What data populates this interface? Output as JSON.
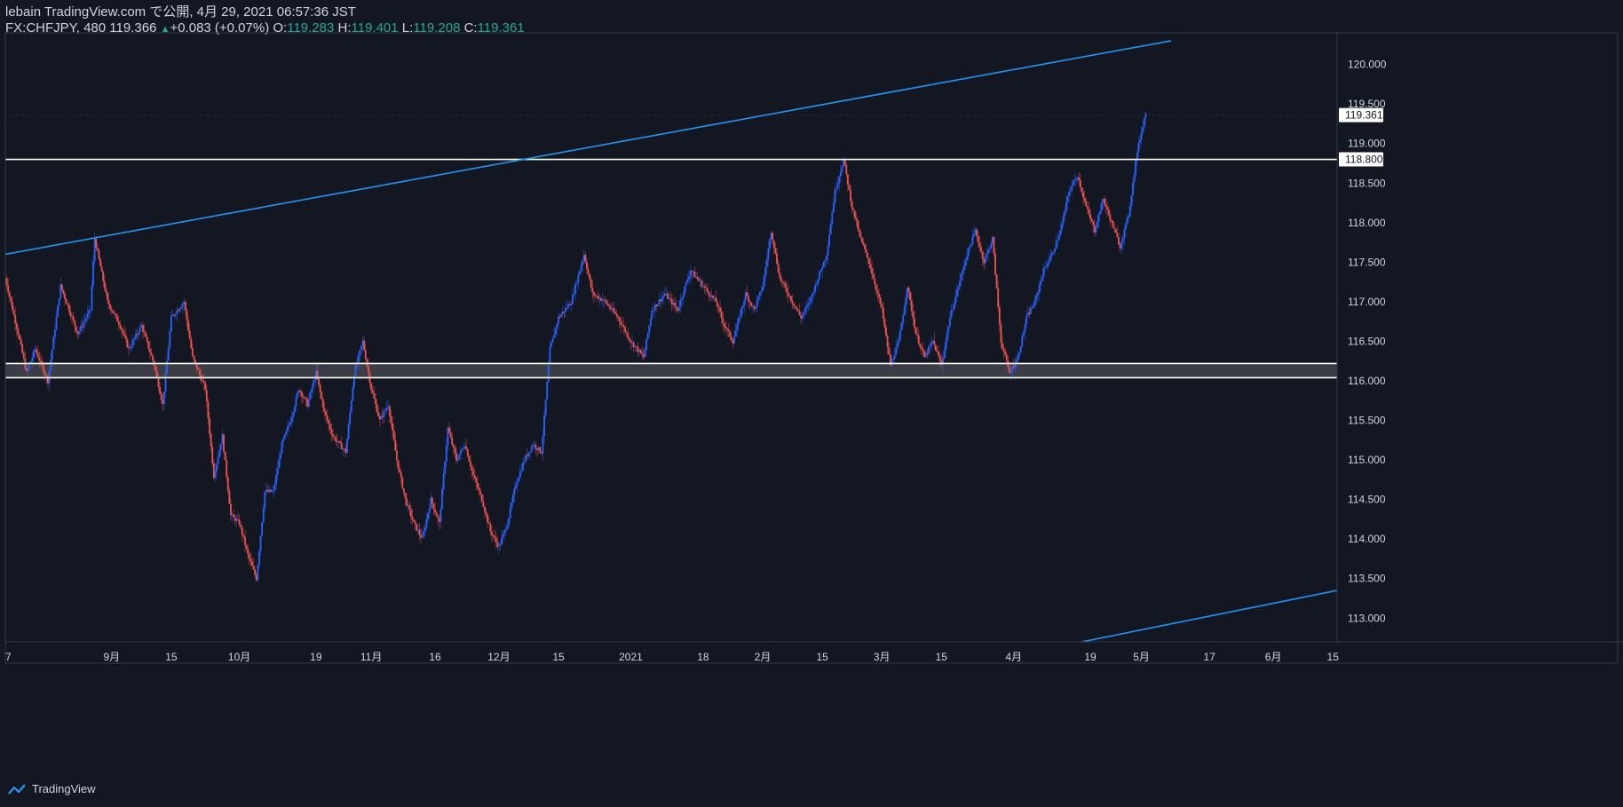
{
  "header": {
    "title": "lebain TradingView.com で公開, 4月 29, 2021 06:57:36 JST",
    "symbol_line": "FX:CHFJPY, 480 119.366",
    "change_arrow": "▲",
    "change": "+0.083 (+0.07%)",
    "o_label": "O:",
    "o_value": "119.283",
    "h_label": "H:",
    "h_value": "119.401",
    "l_label": "L:",
    "l_value": "119.208",
    "c_label": "C:",
    "c_value": "119.361"
  },
  "footer": {
    "brand": "TradingView"
  },
  "colors": {
    "background": "#131722",
    "up": "#2962ff",
    "down": "#ef5350",
    "trendline": "#2196f3",
    "level": "#ffffff",
    "zone_fill": "#3a3d45",
    "axis_text": "#d1d4dc",
    "price_tag_fill": "#ffffff",
    "price_tag_text": "#131722"
  },
  "chart_data": {
    "type": "candlestick",
    "symbol": "FX:CHFJPY",
    "interval": "480",
    "x_tick_labels": [
      "7",
      "9月",
      "15",
      "10月",
      "19",
      "11月",
      "16",
      "12月",
      "15",
      "2021",
      "18",
      "2月",
      "15",
      "3月",
      "15",
      "4月",
      "19",
      "5月",
      "17",
      "6月",
      "15"
    ],
    "x_tick_dates": [
      "2020-08-07",
      "2020-09-01",
      "2020-09-15",
      "2020-10-01",
      "2020-10-19",
      "2020-11-01",
      "2020-11-16",
      "2020-12-01",
      "2020-12-15",
      "2021-01-01",
      "2021-01-18",
      "2021-02-01",
      "2021-02-15",
      "2021-03-01",
      "2021-03-15",
      "2021-04-01",
      "2021-04-19",
      "2021-05-01",
      "2021-05-17",
      "2021-06-01",
      "2021-06-15"
    ],
    "y_ticks": [
      113.0,
      113.5,
      114.0,
      114.5,
      115.0,
      115.5,
      116.0,
      116.5,
      117.0,
      117.5,
      118.0,
      118.5,
      119.0,
      119.5,
      120.0
    ],
    "y_tick_labels": [
      "113.000",
      "113.500",
      "114.000",
      "114.500",
      "115.000",
      "115.500",
      "116.000",
      "116.500",
      "117.000",
      "117.500",
      "118.000",
      "118.500",
      "119.000",
      "119.500",
      "120.000"
    ],
    "ylim": [
      112.7,
      120.4
    ],
    "xlim": [
      "2020-08-07",
      "2021-06-16"
    ],
    "price_path": [
      [
        "2020-08-07",
        117.3
      ],
      [
        "2020-08-10",
        116.6
      ],
      [
        "2020-08-12",
        116.1
      ],
      [
        "2020-08-14",
        116.4
      ],
      [
        "2020-08-17",
        116.0
      ],
      [
        "2020-08-20",
        117.2
      ],
      [
        "2020-08-22",
        116.9
      ],
      [
        "2020-08-24",
        116.6
      ],
      [
        "2020-08-27",
        116.9
      ],
      [
        "2020-08-28",
        117.8
      ],
      [
        "2020-08-31",
        117.0
      ],
      [
        "2020-09-03",
        116.7
      ],
      [
        "2020-09-05",
        116.4
      ],
      [
        "2020-09-08",
        116.7
      ],
      [
        "2020-09-11",
        116.2
      ],
      [
        "2020-09-13",
        115.7
      ],
      [
        "2020-09-15",
        116.8
      ],
      [
        "2020-09-18",
        117.0
      ],
      [
        "2020-09-20",
        116.3
      ],
      [
        "2020-09-23",
        115.9
      ],
      [
        "2020-09-25",
        114.8
      ],
      [
        "2020-09-27",
        115.3
      ],
      [
        "2020-09-29",
        114.3
      ],
      [
        "2020-10-01",
        114.2
      ],
      [
        "2020-10-03",
        113.8
      ],
      [
        "2020-10-05",
        113.5
      ],
      [
        "2020-10-07",
        114.6
      ],
      [
        "2020-10-09",
        114.6
      ],
      [
        "2020-10-11",
        115.2
      ],
      [
        "2020-10-13",
        115.5
      ],
      [
        "2020-10-15",
        115.9
      ],
      [
        "2020-10-17",
        115.7
      ],
      [
        "2020-10-19",
        116.1
      ],
      [
        "2020-10-21",
        115.6
      ],
      [
        "2020-10-23",
        115.3
      ],
      [
        "2020-10-26",
        115.1
      ],
      [
        "2020-10-28",
        116.1
      ],
      [
        "2020-10-30",
        116.5
      ],
      [
        "2020-11-01",
        115.9
      ],
      [
        "2020-11-03",
        115.5
      ],
      [
        "2020-11-05",
        115.7
      ],
      [
        "2020-11-07",
        115.0
      ],
      [
        "2020-11-09",
        114.5
      ],
      [
        "2020-11-11",
        114.2
      ],
      [
        "2020-11-13",
        114.0
      ],
      [
        "2020-11-15",
        114.5
      ],
      [
        "2020-11-17",
        114.2
      ],
      [
        "2020-11-19",
        115.4
      ],
      [
        "2020-11-21",
        115.0
      ],
      [
        "2020-11-23",
        115.2
      ],
      [
        "2020-11-25",
        114.8
      ],
      [
        "2020-11-27",
        114.5
      ],
      [
        "2020-11-29",
        114.1
      ],
      [
        "2020-12-01",
        113.9
      ],
      [
        "2020-12-03",
        114.2
      ],
      [
        "2020-12-05",
        114.7
      ],
      [
        "2020-12-07",
        115.0
      ],
      [
        "2020-12-09",
        115.2
      ],
      [
        "2020-12-11",
        115.1
      ],
      [
        "2020-12-13",
        116.4
      ],
      [
        "2020-12-15",
        116.8
      ],
      [
        "2020-12-18",
        117.0
      ],
      [
        "2020-12-21",
        117.6
      ],
      [
        "2020-12-23",
        117.1
      ],
      [
        "2020-12-26",
        117.0
      ],
      [
        "2020-12-29",
        116.8
      ],
      [
        "2021-01-01",
        116.5
      ],
      [
        "2021-01-04",
        116.3
      ],
      [
        "2021-01-06",
        116.9
      ],
      [
        "2021-01-09",
        117.1
      ],
      [
        "2021-01-12",
        116.9
      ],
      [
        "2021-01-15",
        117.4
      ],
      [
        "2021-01-18",
        117.2
      ],
      [
        "2021-01-21",
        117.0
      ],
      [
        "2021-01-23",
        116.7
      ],
      [
        "2021-01-25",
        116.5
      ],
      [
        "2021-01-28",
        117.1
      ],
      [
        "2021-01-30",
        116.9
      ],
      [
        "2021-02-01",
        117.2
      ],
      [
        "2021-02-03",
        117.9
      ],
      [
        "2021-02-05",
        117.3
      ],
      [
        "2021-02-08",
        117.0
      ],
      [
        "2021-02-10",
        116.8
      ],
      [
        "2021-02-12",
        117.0
      ],
      [
        "2021-02-14",
        117.3
      ],
      [
        "2021-02-16",
        117.6
      ],
      [
        "2021-02-18",
        118.4
      ],
      [
        "2021-02-20",
        118.8
      ],
      [
        "2021-02-22",
        118.2
      ],
      [
        "2021-02-24",
        117.8
      ],
      [
        "2021-02-26",
        117.5
      ],
      [
        "2021-03-01",
        116.9
      ],
      [
        "2021-03-03",
        116.2
      ],
      [
        "2021-03-05",
        116.5
      ],
      [
        "2021-03-07",
        117.2
      ],
      [
        "2021-03-09",
        116.6
      ],
      [
        "2021-03-11",
        116.3
      ],
      [
        "2021-03-13",
        116.5
      ],
      [
        "2021-03-15",
        116.2
      ],
      [
        "2021-03-17",
        116.8
      ],
      [
        "2021-03-19",
        117.2
      ],
      [
        "2021-03-21",
        117.6
      ],
      [
        "2021-03-23",
        117.9
      ],
      [
        "2021-03-25",
        117.5
      ],
      [
        "2021-03-27",
        117.8
      ],
      [
        "2021-03-29",
        116.5
      ],
      [
        "2021-03-31",
        116.1
      ],
      [
        "2021-04-02",
        116.3
      ],
      [
        "2021-04-04",
        116.8
      ],
      [
        "2021-04-06",
        117.0
      ],
      [
        "2021-04-08",
        117.4
      ],
      [
        "2021-04-10",
        117.6
      ],
      [
        "2021-04-12",
        117.9
      ],
      [
        "2021-04-14",
        118.4
      ],
      [
        "2021-04-16",
        118.6
      ],
      [
        "2021-04-18",
        118.2
      ],
      [
        "2021-04-20",
        117.9
      ],
      [
        "2021-04-22",
        118.3
      ],
      [
        "2021-04-24",
        118.0
      ],
      [
        "2021-04-26",
        117.7
      ],
      [
        "2021-04-28",
        118.1
      ],
      [
        "2021-04-30",
        118.9
      ],
      [
        "2021-05-02",
        119.4
      ]
    ],
    "trendlines": [
      {
        "name": "upper-channel",
        "from": [
          "2020-08-07",
          117.6
        ],
        "to": [
          "2021-05-08",
          120.3
        ]
      },
      {
        "name": "lower-channel",
        "from": [
          "2021-04-17",
          112.7
        ],
        "to": [
          "2021-06-16",
          113.35
        ]
      }
    ],
    "horizontal_levels": [
      116.22,
      116.04,
      118.8
    ],
    "zone": [
      116.04,
      116.22
    ],
    "price_tags": [
      "119.361",
      "118.800"
    ],
    "grid": false,
    "legend": "none"
  }
}
